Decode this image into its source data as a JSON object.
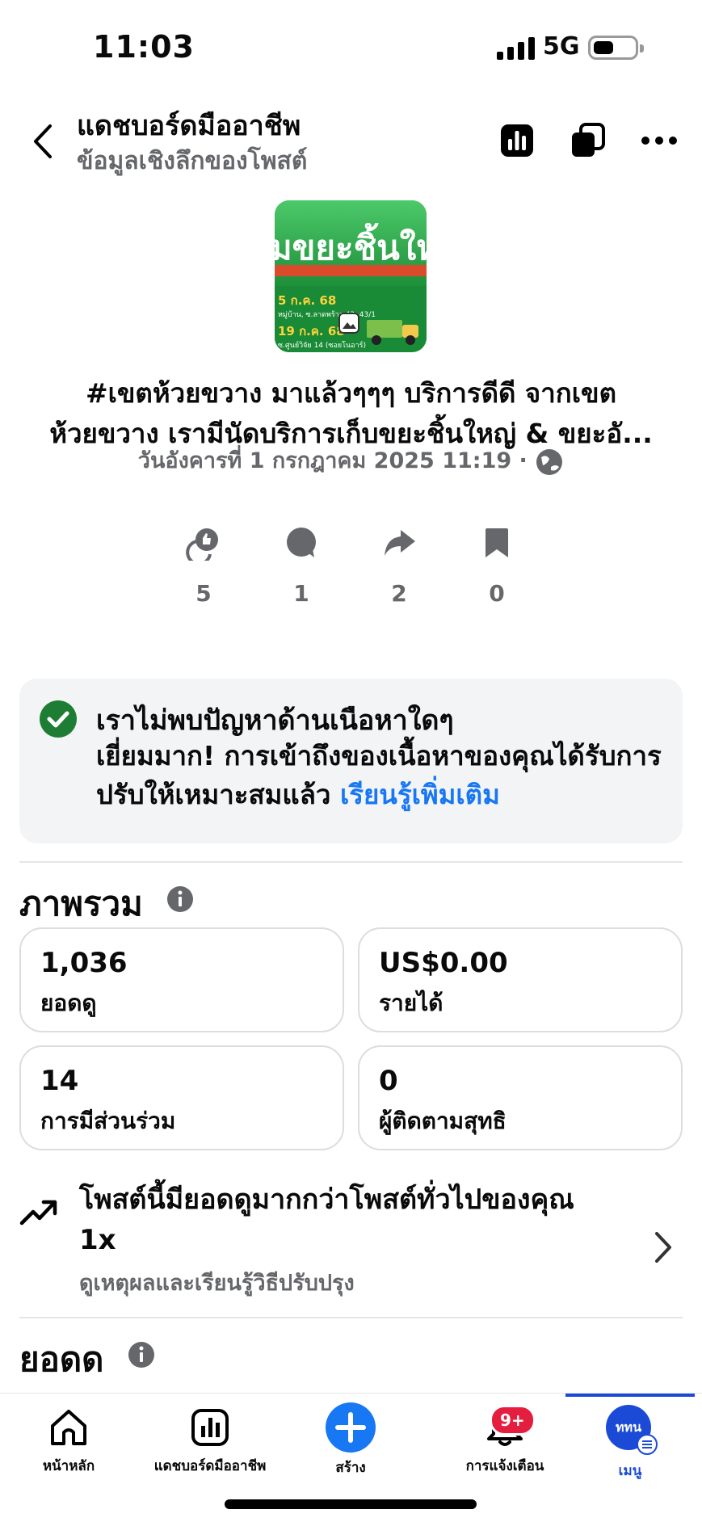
{
  "status_bar": {
    "time": "11:03",
    "network": "5G"
  },
  "header": {
    "title": "แดชบอร์ดมืออาชีพ",
    "subtitle": "ข้อมูลเชิงลึกของโพสต์"
  },
  "post": {
    "thumbnail": {
      "headline": "มขยะชิ้นให",
      "date_1": "5 ก.ค. 68",
      "date_2": "19 ก.ค. 68",
      "detail_1": "หมู่บ้าน, ซ.ลาดพร้าว 43, 43/1",
      "detail_2": "ซ.ศูนย์วิจัย 14 (ซอยโนอาร์)"
    },
    "text": "#เขตห้วยขวาง มาแล้วๆๆๆ บริการดีดี จากเขตห้วยขวาง เรามีนัดบริการเก็บขยะชิ้นใหญ่ & ขยะอั...",
    "meta": "วันอังคารที่ 1 กรกฎาคม  2025 11:19 ·",
    "stats": [
      {
        "icon": "reaction-icon",
        "value": "5"
      },
      {
        "icon": "comment-icon",
        "value": "1"
      },
      {
        "icon": "share-icon",
        "value": "2"
      },
      {
        "icon": "bookmark-icon",
        "value": "0"
      }
    ]
  },
  "content_check": {
    "title": "เราไม่พบปัญหาด้านเนือหาใดๆ",
    "body": "เยี่ยมมาก! การเข้าถึงของเนื้อหาของคุณได้รับการปรับให้เหมาะสมแล้ว",
    "link": "เรียนรู้เพิ่มเติม"
  },
  "overview": {
    "title": "ภาพรวม",
    "metrics": [
      {
        "value": "1,036",
        "label": "ยอดดู"
      },
      {
        "value": "US$0.00",
        "label": "รายได้"
      },
      {
        "value": "14",
        "label": "การมีส่วนร่วม"
      },
      {
        "value": "0",
        "label": "ผู้ติดตามสุทธิ"
      }
    ]
  },
  "insight": {
    "title": "โพสต์นี้มียอดดูมากกว่าโพสต์ทั่วไปของคุณ 1x",
    "subtitle": "ดูเหตุผลและเรียนรู้วิธีปรับปรุง"
  },
  "views_section": {
    "title": "ยอดด"
  },
  "bottom_nav": {
    "items": [
      {
        "label": "หน้าหลัก"
      },
      {
        "label": "แดชบอร์ดมืออาชีพ"
      },
      {
        "label": "สร้าง"
      },
      {
        "label": "การแจ้งเตือน",
        "badge": "9+"
      },
      {
        "label": "เมนู",
        "avatar_text": "ททน"
      }
    ]
  },
  "colors": {
    "accent": "#1877f2",
    "success": "#1e7d34",
    "badge": "#e41e3f",
    "nav_active": "#1b4bd6"
  }
}
